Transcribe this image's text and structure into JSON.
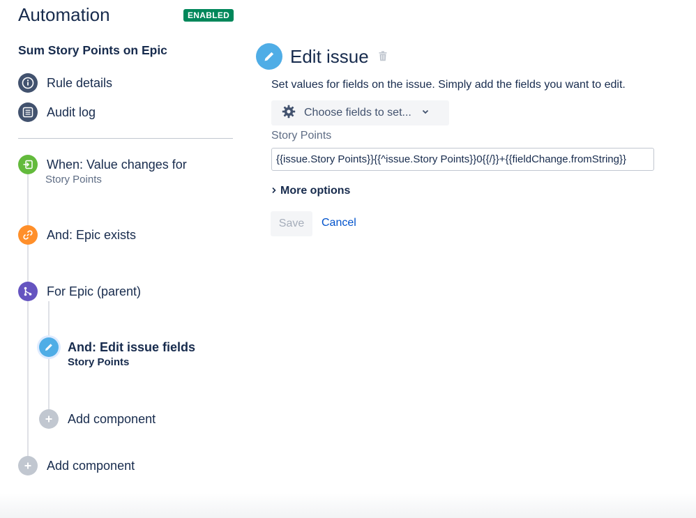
{
  "header": {
    "title": "Automation",
    "status_badge": "ENABLED"
  },
  "sidebar": {
    "rule_name": "Sum Story Points on Epic",
    "nav": [
      {
        "label": "Rule details",
        "icon": "info-icon"
      },
      {
        "label": "Audit log",
        "icon": "list-icon"
      }
    ],
    "steps": {
      "trigger": {
        "title": "When: Value changes for",
        "subtitle": "Story Points",
        "icon": "trigger-icon",
        "color": "#63ba3c"
      },
      "condition": {
        "title": "And: Epic exists",
        "icon": "link-icon",
        "color": "#ff8f2a"
      },
      "branch": {
        "title": "For Epic (parent)",
        "icon": "branch-icon",
        "color": "#6554c0"
      },
      "action": {
        "title": "And: Edit issue fields",
        "subtitle": "Story Points",
        "icon": "pencil-icon",
        "color": "#4fade6"
      },
      "add_inner": {
        "label": "Add component",
        "icon": "plus-icon"
      },
      "add_outer": {
        "label": "Add component",
        "icon": "plus-icon"
      }
    }
  },
  "panel": {
    "heading": "Edit issue",
    "description": "Set values for fields on the issue. Simply add the fields you want to edit.",
    "choose_fields_label": "Choose fields to set...",
    "field_label": "Story Points",
    "field_value": "{{issue.Story Points}}{{^issue.Story Points}}0{{/}}+{{fieldChange.fromString}}",
    "more_options_label": "More options",
    "save_label": "Save",
    "cancel_label": "Cancel"
  }
}
